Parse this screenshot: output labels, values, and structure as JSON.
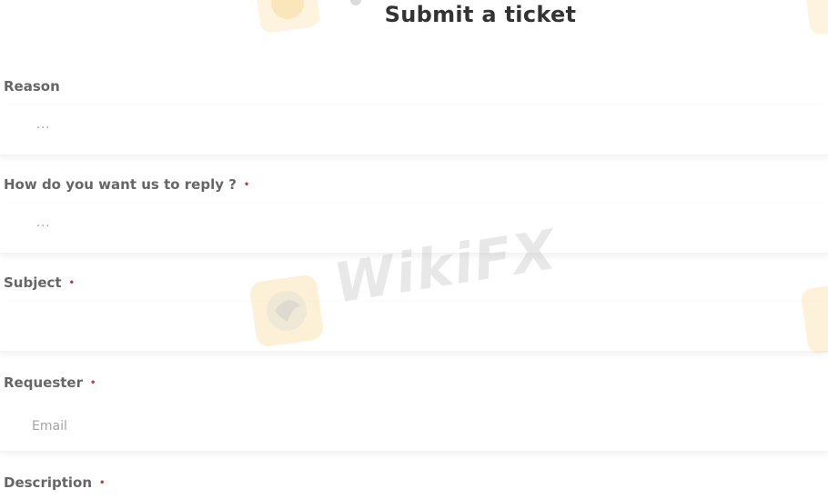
{
  "page": {
    "title": "Submit a ticket"
  },
  "form": {
    "reason": {
      "label": "Reason",
      "value": "..."
    },
    "reply": {
      "label": "How do you want us to reply ?",
      "required_mark": "•",
      "value": "..."
    },
    "subject": {
      "label": "Subject",
      "required_mark": "•",
      "value": ""
    },
    "requester": {
      "label": "Requester",
      "required_mark": "•",
      "placeholder": "Email"
    },
    "description": {
      "label": "Description",
      "required_mark": "•"
    }
  },
  "watermark": {
    "text": "WikiFX",
    "icon": "wikifx-logo-icon"
  },
  "colors": {
    "required": "#d9342b",
    "label": "#666666",
    "title": "#333333",
    "watermark_logo": "#f6c96a"
  }
}
